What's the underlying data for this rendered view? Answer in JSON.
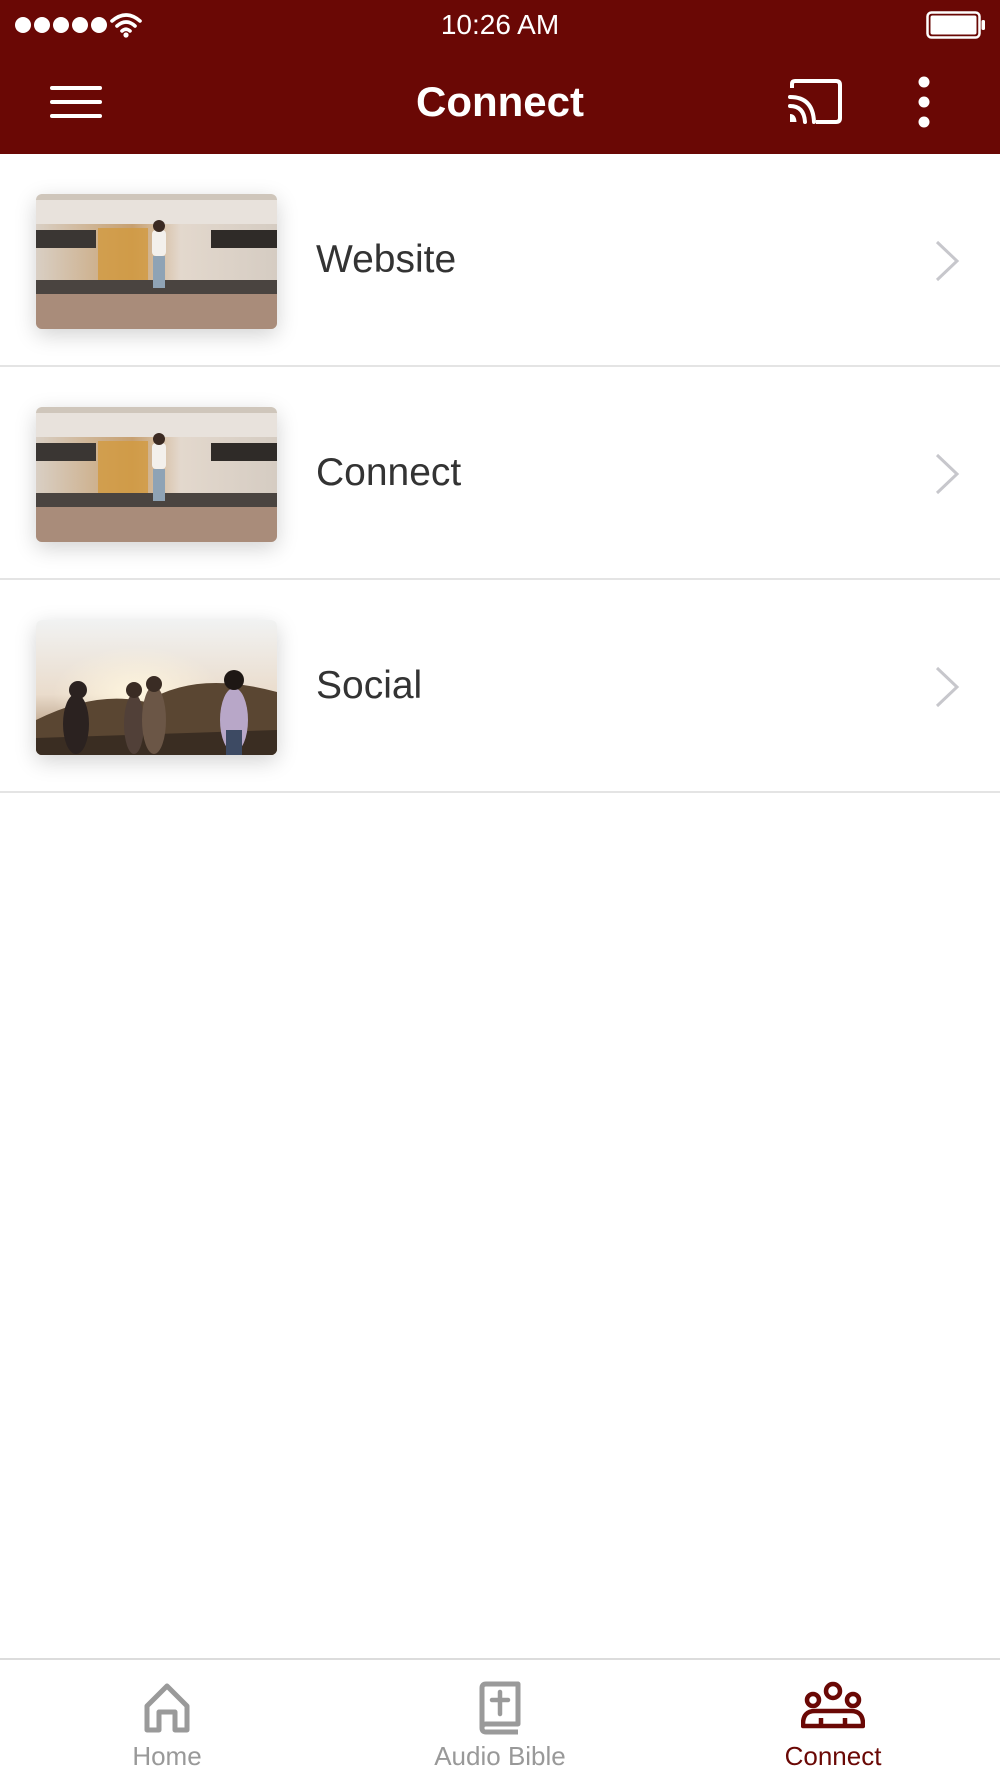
{
  "status_bar": {
    "time": "10:26 AM",
    "signal_icon": "cell-signal-icon",
    "wifi_icon": "wifi-icon",
    "battery_icon": "battery-icon"
  },
  "nav_bar": {
    "title": "Connect",
    "menu_icon": "hamburger-menu-icon",
    "cast_icon": "cast-icon",
    "more_icon": "more-vertical-icon",
    "background_color": "#6a0805"
  },
  "list": {
    "items": [
      {
        "label": "Website",
        "thumbnail": "train-platform-photo",
        "chevron_icon": "chevron-right-icon"
      },
      {
        "label": "Connect",
        "thumbnail": "train-platform-photo",
        "chevron_icon": "chevron-right-icon"
      },
      {
        "label": "Social",
        "thumbnail": "group-sunset-photo",
        "chevron_icon": "chevron-right-icon"
      }
    ]
  },
  "tab_bar": {
    "tabs": [
      {
        "label": "Home",
        "icon": "home-icon",
        "active": false
      },
      {
        "label": "Audio Bible",
        "icon": "bible-icon",
        "active": false
      },
      {
        "label": "Connect",
        "icon": "people-group-icon",
        "active": true
      }
    ],
    "active_color": "#6a0805",
    "inactive_color": "#999999"
  }
}
